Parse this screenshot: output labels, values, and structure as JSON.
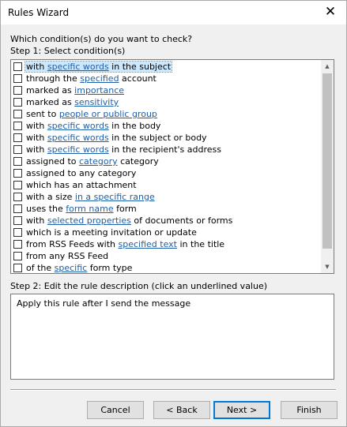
{
  "window": {
    "title": "Rules Wizard"
  },
  "close_glyph": "✕",
  "question": "Which condition(s) do you want to check?",
  "step1_label": "Step 1: Select condition(s)",
  "conditions": [
    {
      "parts": [
        {
          "t": "with "
        },
        {
          "t": "specific words",
          "link": true
        },
        {
          "t": " in the subject"
        }
      ],
      "checked": false,
      "selected": true
    },
    {
      "parts": [
        {
          "t": "through the "
        },
        {
          "t": "specified",
          "link": true
        },
        {
          "t": " account"
        }
      ],
      "checked": false
    },
    {
      "parts": [
        {
          "t": "marked as "
        },
        {
          "t": "importance",
          "link": true
        }
      ],
      "checked": false
    },
    {
      "parts": [
        {
          "t": "marked as "
        },
        {
          "t": "sensitivity",
          "link": true
        }
      ],
      "checked": false
    },
    {
      "parts": [
        {
          "t": "sent to "
        },
        {
          "t": "people or public group",
          "link": true
        }
      ],
      "checked": false
    },
    {
      "parts": [
        {
          "t": "with "
        },
        {
          "t": "specific words",
          "link": true
        },
        {
          "t": " in the body"
        }
      ],
      "checked": false
    },
    {
      "parts": [
        {
          "t": "with "
        },
        {
          "t": "specific words",
          "link": true
        },
        {
          "t": " in the subject or body"
        }
      ],
      "checked": false
    },
    {
      "parts": [
        {
          "t": "with "
        },
        {
          "t": "specific words",
          "link": true
        },
        {
          "t": " in the recipient's address"
        }
      ],
      "checked": false
    },
    {
      "parts": [
        {
          "t": "assigned to "
        },
        {
          "t": "category",
          "link": true
        },
        {
          "t": " category"
        }
      ],
      "checked": false
    },
    {
      "parts": [
        {
          "t": "assigned to any category"
        }
      ],
      "checked": false
    },
    {
      "parts": [
        {
          "t": "which has an attachment"
        }
      ],
      "checked": false
    },
    {
      "parts": [
        {
          "t": "with a size "
        },
        {
          "t": "in a specific range",
          "link": true
        }
      ],
      "checked": false
    },
    {
      "parts": [
        {
          "t": "uses the "
        },
        {
          "t": "form name",
          "link": true
        },
        {
          "t": " form"
        }
      ],
      "checked": false
    },
    {
      "parts": [
        {
          "t": "with "
        },
        {
          "t": "selected properties",
          "link": true
        },
        {
          "t": " of documents or forms"
        }
      ],
      "checked": false
    },
    {
      "parts": [
        {
          "t": "which is a meeting invitation or update"
        }
      ],
      "checked": false
    },
    {
      "parts": [
        {
          "t": "from RSS Feeds with "
        },
        {
          "t": "specified text",
          "link": true
        },
        {
          "t": " in the title"
        }
      ],
      "checked": false
    },
    {
      "parts": [
        {
          "t": "from any RSS Feed"
        }
      ],
      "checked": false
    },
    {
      "parts": [
        {
          "t": "of the "
        },
        {
          "t": "specific",
          "link": true
        },
        {
          "t": " form type"
        }
      ],
      "checked": false
    }
  ],
  "step2_label": "Step 2: Edit the rule description (click an underlined value)",
  "description": "Apply this rule after I send the message",
  "buttons": {
    "cancel": "Cancel",
    "back": "< Back",
    "next": "Next >",
    "finish": "Finish"
  },
  "colors": {
    "link": "#1f5ea8",
    "selection": "#cce8ff",
    "default_button_border": "#0078d7"
  }
}
